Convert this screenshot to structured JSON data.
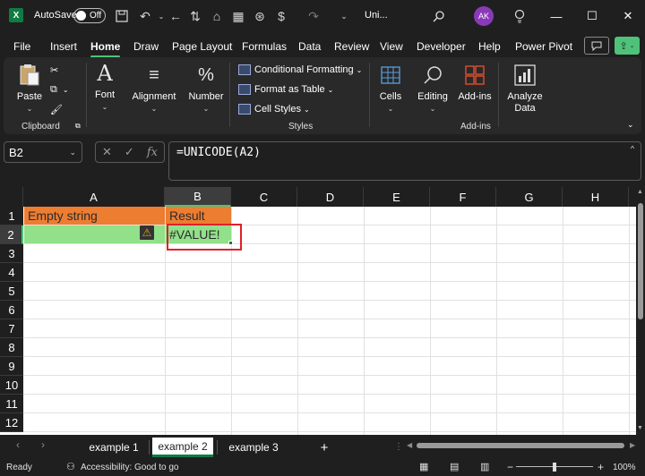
{
  "titlebar": {
    "app_logo": "X",
    "autosave_label": "AutoSave",
    "autosave_state": "Off",
    "doc_title": "Uni...",
    "avatar_initials": "AK",
    "icons": [
      "save-icon",
      "undo-icon",
      "redo-icon",
      "search-icon",
      "lightbulb-icon",
      "minimize-icon",
      "maximize-icon",
      "close-icon"
    ]
  },
  "menu": {
    "tabs": [
      "File",
      "Insert",
      "Home",
      "Draw",
      "Page Layout",
      "Formulas",
      "Data",
      "Review",
      "View",
      "Developer",
      "Help",
      "Power Pivot"
    ],
    "active": "Home"
  },
  "ribbon": {
    "paste": "Paste",
    "clipboard_group": "Clipboard",
    "font": "Font",
    "alignment": "Alignment",
    "number": "Number",
    "conditional_formatting": "Conditional Formatting",
    "format_as_table": "Format as Table",
    "cell_styles": "Cell Styles",
    "styles_group": "Styles",
    "cells": "Cells",
    "editing": "Editing",
    "addins": "Add-ins",
    "addins_group": "Add-ins",
    "analyze_data": "Analyze Data"
  },
  "formula_bar": {
    "name_box": "B2",
    "formula": "=UNICODE(A2)"
  },
  "grid": {
    "columns": [
      "A",
      "B",
      "C",
      "D",
      "E",
      "F",
      "G",
      "H"
    ],
    "selected_column": "B",
    "rows": [
      "1",
      "2",
      "3",
      "4",
      "5",
      "6",
      "7",
      "8",
      "9",
      "10",
      "11",
      "12"
    ],
    "selected_row": "2",
    "cells": {
      "A1": "Empty string",
      "B1": "Result",
      "A2": "",
      "B2": "#VALUE!"
    },
    "colors": {
      "header_fill": "#ed7d31",
      "data_fill": "#92e08a",
      "highlight_border": "#e0202a",
      "accent": "#107c41"
    }
  },
  "sheets": {
    "tabs": [
      "example 1",
      "example 2",
      "example 3"
    ],
    "active": "example 2",
    "add_label": "+"
  },
  "status": {
    "ready": "Ready",
    "accessibility": "Accessibility: Good to go",
    "zoom": "100%",
    "zoom_minus": "−",
    "zoom_plus": "+"
  }
}
